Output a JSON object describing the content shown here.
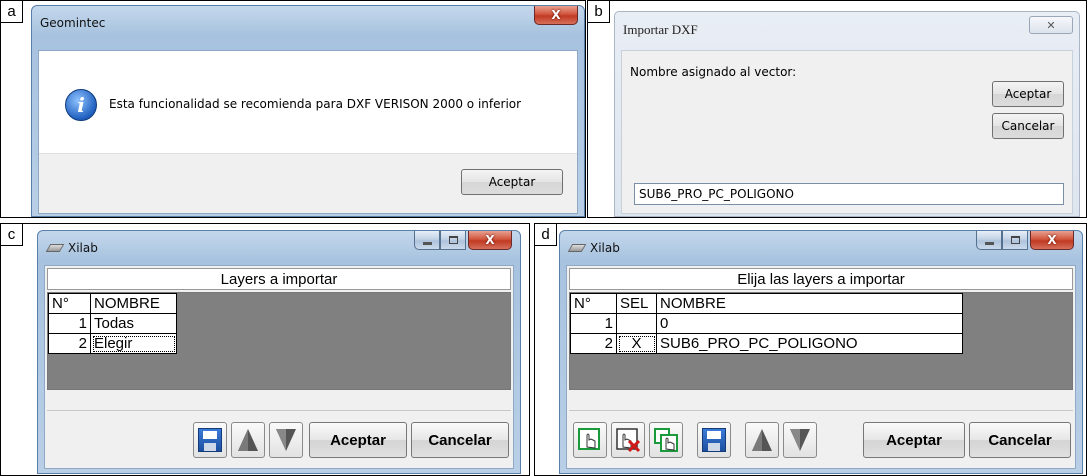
{
  "panels": {
    "a": {
      "label": "a",
      "title": "Geomintec",
      "close": "X",
      "message": "Esta funcionalidad se recomienda para DXF VERISON 2000 o inferior",
      "ok": "Aceptar"
    },
    "b": {
      "label": "b",
      "title": "Importar DXF",
      "close": "✕",
      "prompt": "Nombre asignado al vector:",
      "accept": "Aceptar",
      "cancel": "Cancelar",
      "value": "SUB6_PRO_PC_POLIGONO"
    },
    "c": {
      "label": "c",
      "title": "Xilab",
      "close": "X",
      "header": "Layers a importar",
      "columns": [
        "N°",
        "NOMBRE"
      ],
      "rows": [
        {
          "n": "1",
          "name": "Todas"
        },
        {
          "n": "2",
          "name": "Elegir"
        }
      ],
      "accept": "Aceptar",
      "cancel": "Cancelar"
    },
    "d": {
      "label": "d",
      "title": "Xilab",
      "close": "X",
      "header": "Elija las layers a importar",
      "columns": [
        "N°",
        "SEL",
        "NOMBRE"
      ],
      "rows": [
        {
          "n": "1",
          "sel": "",
          "name": "0"
        },
        {
          "n": "2",
          "sel": "X",
          "name": "SUB6_PRO_PC_POLIGONO"
        }
      ],
      "accept": "Aceptar",
      "cancel": "Cancelar"
    }
  }
}
